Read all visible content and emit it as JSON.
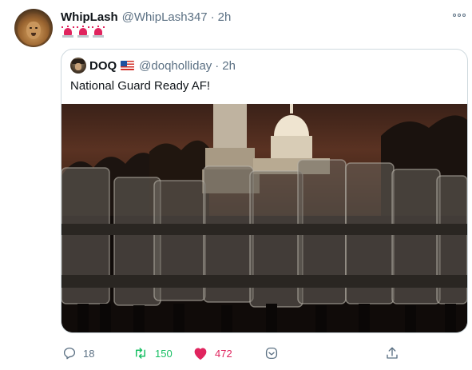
{
  "tweet": {
    "author_name": "WhipLash",
    "author_handle": "@WhipLash347",
    "separator": "·",
    "time": "2h",
    "emoji": [
      "rotating-light-emoji",
      "rotating-light-emoji",
      "rotating-light-emoji"
    ],
    "avatar": "lion-avatar"
  },
  "quoted": {
    "author_name": "DOQ",
    "flag": "us-flag-emoji",
    "author_handle": "@doqholliday",
    "separator": "·",
    "time": "2h",
    "text": "National Guard Ready AF!",
    "media": "photo of riot-shield line in front of the Capitol at night"
  },
  "actions": {
    "reply_count": "18",
    "retweet_count": "150",
    "like_count": "472",
    "icons": [
      "reply-icon",
      "retweet-icon",
      "heart-icon",
      "react-icon",
      "share-icon"
    ]
  },
  "colors": {
    "text_primary": "#0f1419",
    "text_secondary": "#5b7083",
    "retweet_green": "#17bf63",
    "like_pink": "#e0245e",
    "border": "#cfd9de"
  }
}
